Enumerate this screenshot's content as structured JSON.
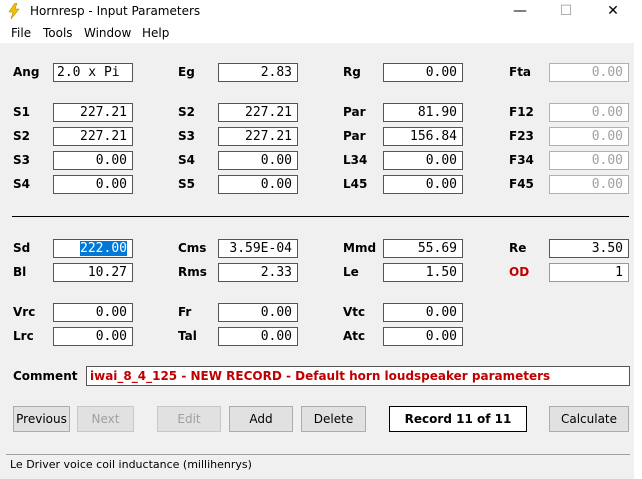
{
  "window": {
    "title": "Hornresp - Input Parameters",
    "minimize_glyph": "—",
    "maximize_glyph": "☐",
    "close_glyph": "✕"
  },
  "menu": [
    "File",
    "Tools",
    "Window",
    "Help"
  ],
  "params": {
    "ang": {
      "label": "Ang",
      "value": "2.0 x Pi"
    },
    "eg": {
      "label": "Eg",
      "value": "2.83"
    },
    "rg": {
      "label": "Rg",
      "value": "0.00"
    },
    "fta": {
      "label": "Fta",
      "value": "0.00"
    },
    "s1": {
      "label": "S1",
      "value": "227.21"
    },
    "s2a": {
      "label": "S2",
      "value": "227.21"
    },
    "par1": {
      "label": "Par",
      "value": "81.90"
    },
    "f12": {
      "label": "F12",
      "value": "0.00"
    },
    "s2b": {
      "label": "S2",
      "value": "227.21"
    },
    "s3a": {
      "label": "S3",
      "value": "227.21"
    },
    "par2": {
      "label": "Par",
      "value": "156.84"
    },
    "f23": {
      "label": "F23",
      "value": "0.00"
    },
    "s3b": {
      "label": "S3",
      "value": "0.00"
    },
    "s4a": {
      "label": "S4",
      "value": "0.00"
    },
    "l34": {
      "label": "L34",
      "value": "0.00"
    },
    "f34": {
      "label": "F34",
      "value": "0.00"
    },
    "s4b": {
      "label": "S4",
      "value": "0.00"
    },
    "s5": {
      "label": "S5",
      "value": "0.00"
    },
    "l45": {
      "label": "L45",
      "value": "0.00"
    },
    "f45": {
      "label": "F45",
      "value": "0.00"
    },
    "sd": {
      "label": "Sd",
      "value": "222.00"
    },
    "cms": {
      "label": "Cms",
      "value": "3.59E-04"
    },
    "mmd": {
      "label": "Mmd",
      "value": "55.69"
    },
    "re": {
      "label": "Re",
      "value": "3.50"
    },
    "bl": {
      "label": "Bl",
      "value": "10.27"
    },
    "rms": {
      "label": "Rms",
      "value": "2.33"
    },
    "le": {
      "label": "Le",
      "value": "1.50"
    },
    "od": {
      "label": "OD",
      "value": "1"
    },
    "vrc": {
      "label": "Vrc",
      "value": "0.00"
    },
    "fr": {
      "label": "Fr",
      "value": "0.00"
    },
    "vtc": {
      "label": "Vtc",
      "value": "0.00"
    },
    "lrc": {
      "label": "Lrc",
      "value": "0.00"
    },
    "tal": {
      "label": "Tal",
      "value": "0.00"
    },
    "atc": {
      "label": "Atc",
      "value": "0.00"
    }
  },
  "comment": {
    "label": "Comment",
    "value": "iwai_8_4_125 - NEW RECORD - Default horn loudspeaker parameters"
  },
  "buttons": {
    "previous": "Previous",
    "next": "Next",
    "edit": "Edit",
    "add": "Add",
    "delete": "Delete",
    "calculate": "Calculate"
  },
  "record": "Record 11 of 11",
  "status": "Le   Driver voice coil inductance  (millihenrys)",
  "colors": {
    "accent_red": "#c00000",
    "selection": "#0078d7",
    "title_icon": "#f2c200"
  }
}
